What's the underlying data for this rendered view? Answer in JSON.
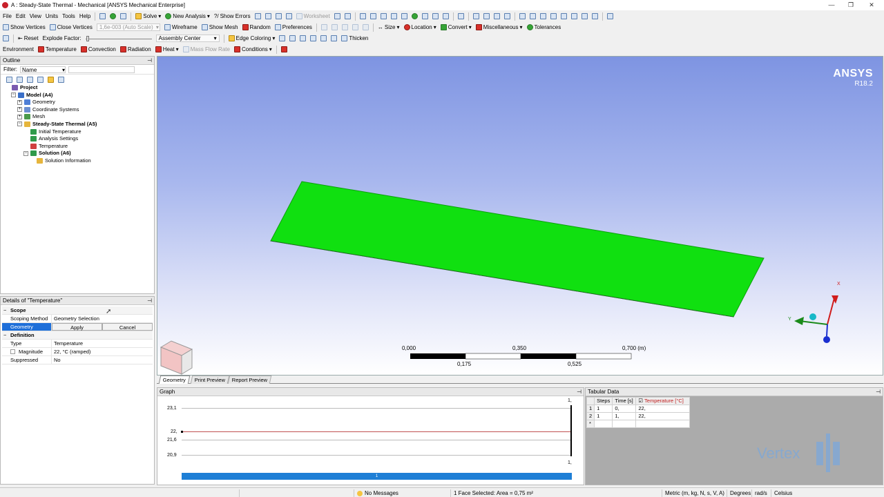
{
  "window": {
    "title": "A : Steady-State Thermal - Mechanical [ANSYS Mechanical Enterprise]",
    "min": "—",
    "max": "❐",
    "close": "✕"
  },
  "menu": [
    "File",
    "Edit",
    "View",
    "Units",
    "Tools",
    "Help"
  ],
  "toolbar1": {
    "solve": "Solve",
    "new_analysis": "New Analysis",
    "show_errors": "Show Errors",
    "worksheet": "Worksheet"
  },
  "toolbar2": {
    "show_vertices": "Show Vertices",
    "close_vertices": "Close Vertices",
    "scale": "1,6e-003 (Auto Scale)",
    "wireframe": "Wireframe",
    "show_mesh": "Show Mesh",
    "random": "Random",
    "preferences": "Preferences",
    "size": "Size",
    "location": "Location",
    "convert": "Convert",
    "miscellaneous": "Miscellaneous",
    "tolerances": "Tolerances"
  },
  "toolbar3": {
    "reset": "Reset",
    "explode_factor": "Explode Factor:",
    "assembly_center": "Assembly Center",
    "edge_coloring": "Edge Coloring",
    "thicken": "Thicken"
  },
  "toolbar4": {
    "environment": "Environment",
    "temperature": "Temperature",
    "convection": "Convection",
    "radiation": "Radiation",
    "heat": "Heat",
    "mass_flow_rate": "Mass Flow Rate",
    "conditions": "Conditions"
  },
  "outline": {
    "title": "Outline",
    "filter_label": "Filter:",
    "filter_value": "Name",
    "tree": [
      {
        "label": "Project",
        "bold": true,
        "level": 0,
        "toggle": "",
        "icon": "#7a5bb0"
      },
      {
        "label": "Model (A4)",
        "bold": true,
        "level": 1,
        "toggle": "−",
        "icon": "#3a6fc8"
      },
      {
        "label": "Geometry",
        "bold": false,
        "level": 2,
        "toggle": "+",
        "icon": "#4f7fd6"
      },
      {
        "label": "Coordinate Systems",
        "bold": false,
        "level": 2,
        "toggle": "+",
        "icon": "#6b8fd0"
      },
      {
        "label": "Mesh",
        "bold": false,
        "level": 2,
        "toggle": "+",
        "icon": "#4a9a4a"
      },
      {
        "label": "Steady-State Thermal (A5)",
        "bold": true,
        "level": 2,
        "toggle": "−",
        "icon": "#e6b53c"
      },
      {
        "label": "Initial Temperature",
        "bold": false,
        "level": 3,
        "toggle": "",
        "icon": "#2f9a4a"
      },
      {
        "label": "Analysis Settings",
        "bold": false,
        "level": 3,
        "toggle": "",
        "icon": "#2f9a4a"
      },
      {
        "label": "Temperature",
        "bold": false,
        "level": 3,
        "toggle": "",
        "icon": "#d04040"
      },
      {
        "label": "Solution (A6)",
        "bold": true,
        "level": 3,
        "toggle": "−",
        "icon": "#2f9a4a"
      },
      {
        "label": "Solution Information",
        "bold": false,
        "level": 4,
        "toggle": "",
        "icon": "#e6b53c"
      }
    ]
  },
  "details": {
    "title": "Details of \"Temperature\"",
    "scope": "Scope",
    "scoping_method_key": "Scoping Method",
    "scoping_method_val": "Geometry Selection",
    "geometry_key": "Geometry",
    "apply": "Apply",
    "cancel": "Cancel",
    "definition": "Definition",
    "type_key": "Type",
    "type_val": "Temperature",
    "magnitude_key": "Magnitude",
    "magnitude_val": "22, °C (ramped)",
    "suppressed_key": "Suppressed",
    "suppressed_val": "No"
  },
  "viewport": {
    "brand": "ANSYS",
    "version": "R18.2",
    "plate_color": "#10e010",
    "axis_x": "X",
    "axis_y": "Y",
    "scale_top": [
      "0,000",
      "0,350",
      "0,700 (m)"
    ],
    "scale_bottom": [
      "0,175",
      "0,525"
    ]
  },
  "view_tabs": [
    "Geometry",
    "Print Preview",
    "Report Preview"
  ],
  "graph": {
    "title": "Graph",
    "yticks": [
      "23,1",
      "22,",
      "21,6",
      "20,9"
    ],
    "top_right": "1,",
    "bottom_right": "1,",
    "timeline_label": "1"
  },
  "tabular": {
    "title": "Tabular Data",
    "headers": [
      "Steps",
      "Time [s]",
      "Temperature [°C]"
    ],
    "rows": [
      {
        "idx": "1",
        "step": "1",
        "time": "0,",
        "temp": "22,"
      },
      {
        "idx": "2",
        "step": "1",
        "time": "1,",
        "temp": "22,"
      },
      {
        "idx": "*",
        "step": "",
        "time": "",
        "temp": ""
      }
    ]
  },
  "watermark": "Vertex",
  "status": {
    "messages": "No Messages",
    "selection": "1 Face Selected: Area = 0,75 m²",
    "units": "Metric (m, kg, N, s, V, A)",
    "degrees": "Degrees",
    "rads": "rad/s",
    "celsius": "Celsius"
  }
}
